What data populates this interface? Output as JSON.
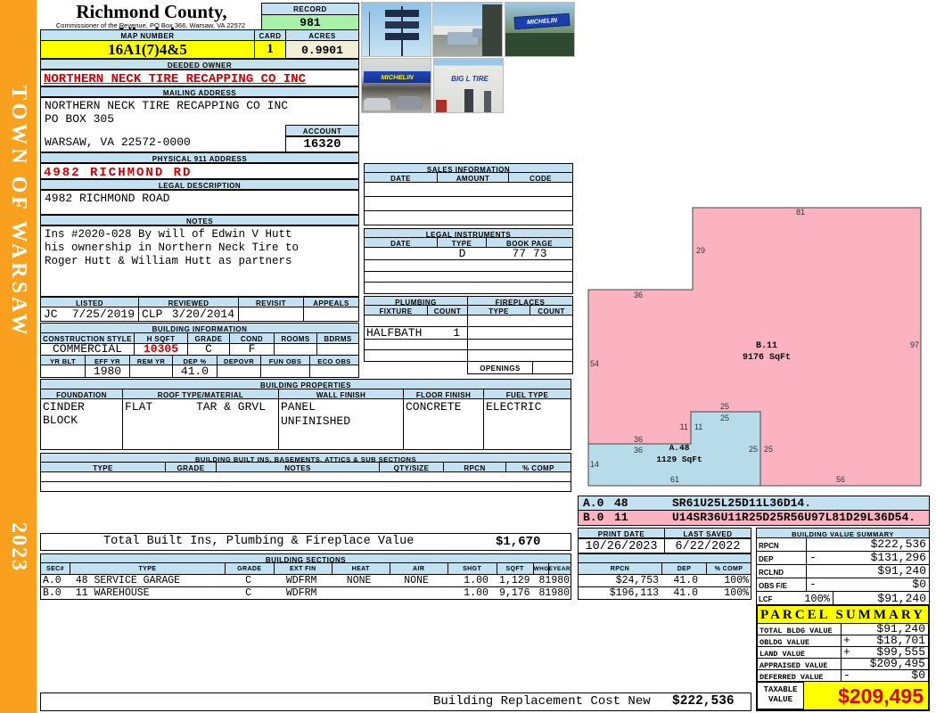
{
  "sidebar": {
    "town": "TOWN OF WARSAW",
    "year": "2023"
  },
  "header": {
    "county": "Richmond County, Virginia",
    "commissioner": "Commissioner of the Revenue, PO Box 366, Warsaw, VA 22572",
    "record_label": "RECORD",
    "record_value": "981",
    "map_label": "MAP NUMBER",
    "map_value": "16A1(7)4&5",
    "card_label": "CARD",
    "card_value": "1",
    "acres_label": "ACRES",
    "acres_value": "0.9901"
  },
  "photos": {
    "michelin": "MICHELIN",
    "big_l": "BIG L TIRE"
  },
  "owner": {
    "label": "DEEDED OWNER",
    "value": "NORTHERN NECK TIRE RECAPPING CO INC"
  },
  "mailing": {
    "label": "MAILING ADDRESS",
    "line1": "NORTHERN NECK TIRE RECAPPING CO INC",
    "line2": "PO BOX 305",
    "line3": "WARSAW, VA 22572-0000",
    "account_label": "ACCOUNT",
    "account_value": "16320"
  },
  "physical": {
    "label": "PHYSICAL 911 ADDRESS",
    "value": "4982 RICHMOND RD"
  },
  "legal": {
    "label": "LEGAL DESCRIPTION",
    "value": "4982 RICHMOND ROAD"
  },
  "notes": {
    "label": "NOTES",
    "line1": "Ins #2020-028 By will of Edwin V Hutt",
    "line2": "his ownership in Northern Neck Tire to",
    "line3": "Roger Hutt & William Hutt as partners"
  },
  "review": {
    "listed_label": "LISTED",
    "reviewed_label": "REVIEWED",
    "revisit_label": "REVISIT",
    "appeals_label": "APPEALS",
    "listed_by": "JC",
    "listed_date": "7/25/2019",
    "reviewed_by": "CLP",
    "reviewed_date": "3/20/2014",
    "revisit": "",
    "appeals": ""
  },
  "building_info": {
    "title": "BUILDING INFORMATION",
    "h1": [
      "CONSTRUCTION STYLE",
      "H SQFT",
      "GRADE",
      "COND",
      "ROOMS",
      "BDRMS"
    ],
    "v1": [
      "COMMERCIAL",
      "10305",
      "C",
      "F",
      "",
      ""
    ],
    "h2": [
      "YR BLT",
      "EFF YR",
      "REM YR",
      "DEP %",
      "DEPOVR",
      "FUN OBS",
      "ECO OBS"
    ],
    "v2": [
      "",
      "1980",
      "",
      "41.0",
      "",
      "",
      ""
    ]
  },
  "properties": {
    "title": "BUILDING PROPERTIES",
    "headers": [
      "FOUNDATION",
      "ROOF TYPE/MATERIAL",
      "WALL FINISH",
      "FLOOR FINISH",
      "FUEL TYPE"
    ],
    "foundation": "CINDER BLOCK",
    "roof_type": "FLAT",
    "roof_material": "TAR & GRVL",
    "wall1": "PANEL",
    "wall2": "UNFINISHED",
    "floor": "CONCRETE",
    "fuel": "ELECTRIC"
  },
  "built_ins": {
    "title": "BUILDING BUILT INS, BASEMENTS, ATTICS & SUB SECTIONS",
    "headers": [
      "TYPE",
      "GRADE",
      "NOTES",
      "QTY/SIZE",
      "RPCN",
      "% COMP"
    ],
    "total_label": "Total Built Ins, Plumbing & Fireplace Value",
    "total_value": "$1,670"
  },
  "sales": {
    "title": "SALES INFORMATION",
    "headers": [
      "DATE",
      "AMOUNT",
      "CODE"
    ]
  },
  "instruments": {
    "title": "LEGAL INSTRUMENTS",
    "headers": [
      "DATE",
      "TYPE",
      "BOOK PAGE"
    ],
    "row1_type": "D",
    "row1_book": "77 73"
  },
  "plumbing": {
    "title": "PLUMBING",
    "headers": [
      "FIXTURE",
      "COUNT"
    ],
    "row2_fixture": "HALFBATH",
    "row2_count": "1"
  },
  "fireplaces": {
    "title": "FIREPLACES",
    "headers": [
      "TYPE",
      "COUNT"
    ],
    "openings_label": "OPENINGS"
  },
  "sketch": {
    "b_label": "B.11",
    "b_sqft": "9176 SqFt",
    "a_label": "A.48",
    "a_sqft": "1129 SqFt",
    "dims": [
      "81",
      "29",
      "36",
      "54",
      "97",
      "25",
      "25",
      "11",
      "11",
      "36",
      "36",
      "25",
      "25",
      "14",
      "61",
      "56"
    ],
    "legend": [
      {
        "sec": "A.0",
        "code": "48",
        "vector": "SR61U25L25D11L36D14."
      },
      {
        "sec": "B.0",
        "code": "11",
        "vector": "U14SR36U11R25D25R56U97L81D29L36D54."
      }
    ]
  },
  "dates": {
    "print_label": "PRINT DATE",
    "print_value": "10/26/2023",
    "saved_label": "LAST SAVED",
    "saved_value": "6/22/2022"
  },
  "value_summary": {
    "title": "BUILDING VALUE SUMMARY",
    "rows": [
      {
        "label": "RPCN",
        "op": "",
        "pct": "",
        "value": "$222,536"
      },
      {
        "label": "DEP",
        "op": "-",
        "pct": "",
        "value": "$131,296"
      },
      {
        "label": "RCLND",
        "op": "",
        "pct": "",
        "value": "$91,240"
      },
      {
        "label": "OBS F/E",
        "op": "-",
        "pct": "",
        "value": "$0"
      },
      {
        "label": "LCF",
        "op": "",
        "pct": "100%",
        "value": "$91,240"
      }
    ]
  },
  "sections": {
    "title": "BUILDING SECTIONS",
    "headers": [
      "SEC#",
      "TYPE",
      "GRADE",
      "EXT FIN",
      "HEAT",
      "AIR",
      "SHGT",
      "SQFT",
      "WHGT",
      "EYEAR",
      "RPCN",
      "DEP",
      "% COMP"
    ],
    "rows": [
      {
        "sec": "A.0",
        "type": "48 SERVICE GARAGE",
        "grade": "C",
        "ext": "WDFRM",
        "heat": "NONE",
        "air": "NONE",
        "shgt": "1.00",
        "sqft": "1,129",
        "whgt": "8",
        "eyear": "1980",
        "rpcn": "$24,753",
        "dep": "41.0",
        "comp": "100%"
      },
      {
        "sec": "B.0",
        "type": "11 WAREHOUSE",
        "grade": "C",
        "ext": "WDFRM",
        "heat": "",
        "air": "",
        "shgt": "1.00",
        "sqft": "9,176",
        "whgt": "8",
        "eyear": "1980",
        "rpcn": "$196,113",
        "dep": "41.0",
        "comp": "100%"
      }
    ]
  },
  "parcel": {
    "title": "PARCEL SUMMARY",
    "rows": [
      {
        "label": "TOTAL BLDG VALUE",
        "op": "",
        "value": "$91,240"
      },
      {
        "label": "OBLDG VALUE",
        "op": "+",
        "value": "$18,701"
      },
      {
        "label": "LAND VALUE",
        "op": "+",
        "value": "$99,555"
      },
      {
        "label": "APPRAISED VALUE",
        "op": "",
        "value": "$209,495"
      },
      {
        "label": "DEFERRED VALUE",
        "op": "-",
        "value": "$0"
      }
    ],
    "taxable_label1": "TAXABLE",
    "taxable_label2": "VALUE",
    "taxable_value": "$209,495"
  },
  "footer": {
    "label": "Building Replacement Cost New",
    "value": "$222,536"
  },
  "colors": {
    "accent_orange": "#F9A11E",
    "header_blue": "#C3E1F0",
    "highlight_yellow": "#FFFF00",
    "record_green": "#A9F1A9",
    "acres_cream": "#F2EDD5",
    "sketch_pink": "#FBB3C2",
    "sketch_blue": "#B7DBE8",
    "alert_red": "#CC0000"
  }
}
